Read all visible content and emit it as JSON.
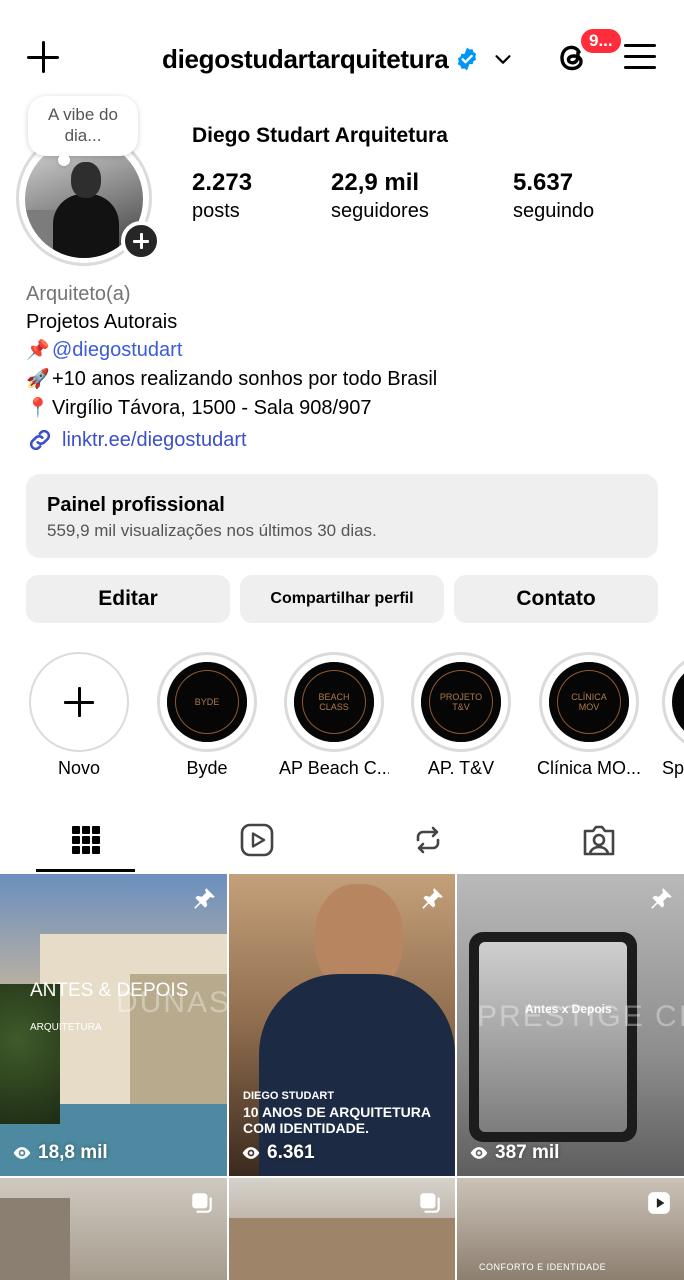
{
  "header": {
    "username": "diegostudartarquitetura",
    "notif_badge": "9..."
  },
  "profile": {
    "note": "A vibe do dia...",
    "full_name": "Diego Studart Arquitetura",
    "stats": [
      {
        "num": "2.273",
        "label": "posts"
      },
      {
        "num": "22,9 mil",
        "label": "seguidores"
      },
      {
        "num": "5.637",
        "label": "seguindo"
      }
    ],
    "category": "Arquiteto(a)",
    "bio_lines": [
      {
        "emoji": "",
        "text": "Projetos Autorais"
      },
      {
        "emoji": "📌",
        "text": "@diegostudart"
      },
      {
        "emoji": "🚀",
        "text": "+10 anos realizando sonhos por todo Brasil"
      },
      {
        "emoji": "📍",
        "text": "Virgílio Távora, 1500 - Sala 908/907"
      }
    ],
    "link": "linktr.ee/diegostudart"
  },
  "pro_panel": {
    "title": "Painel profissional",
    "subtitle": "559,9 mil visualizações nos últimos 30 dias."
  },
  "actions": {
    "edit": "Editar",
    "share": "Compartilhar perfil",
    "contact": "Contato"
  },
  "highlights": [
    {
      "label": "Novo",
      "cover": ""
    },
    {
      "label": "Byde",
      "cover": "BYDE"
    },
    {
      "label": "AP Beach C...",
      "cover": "BEACH CLASS"
    },
    {
      "label": "AP. T&V",
      "cover": "PROJETO T&V"
    },
    {
      "label": "Clínica MO...",
      "cover": "CLÍNICA MOV"
    },
    {
      "label": "Sp",
      "cover": ""
    }
  ],
  "tabs": [
    "grid-icon",
    "reels-icon",
    "reposts-icon",
    "tagged-icon"
  ],
  "posts": [
    {
      "views": "18,8 mil",
      "title": "ANTES & DEPOIS",
      "sub": "ARQUITETURA",
      "watermark": "DUNAS"
    },
    {
      "views": "6.361",
      "kicker": "DIEGO STUDART",
      "headline": "10 ANOS DE ARQUITETURA COM IDENTIDADE."
    },
    {
      "views": "387 mil",
      "caption": "Antes x Depois",
      "watermark": "PRESTIGE CIT"
    },
    {
      "caption": ""
    },
    {
      "caption": ""
    },
    {
      "caption": "CONFORTO E IDENTIDADE"
    }
  ],
  "colors": {
    "verified": "#0095f6",
    "badge": "#ff2d3b",
    "link": "#3b4fc8",
    "panel_bg": "#efefef"
  }
}
